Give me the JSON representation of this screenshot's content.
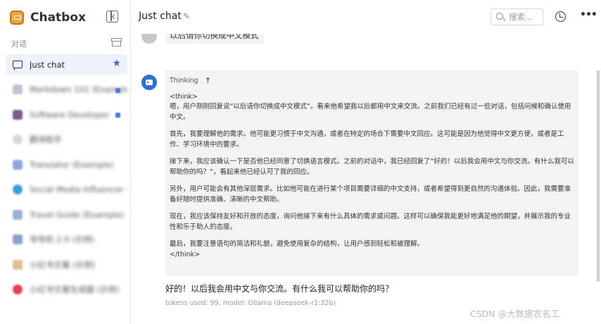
{
  "app": {
    "name": "Chatbox"
  },
  "sidebar": {
    "section_label": "对话",
    "items": [
      {
        "label": "Just chat",
        "icon": "message-icon",
        "active": true,
        "starred": true
      },
      {
        "label": "Markdown 101 (Example)",
        "icon": "image-icon"
      },
      {
        "label": "Software Developer",
        "icon": "image-icon"
      },
      {
        "label": "翻译助手",
        "icon": "avatar-icon"
      },
      {
        "label": "Translator (Example)",
        "icon": "avatar-icon"
      },
      {
        "label": "Social Media Influencer (Example)",
        "icon": "avatar-icon"
      },
      {
        "label": "Travel Guide (Example)",
        "icon": "avatar-icon"
      },
      {
        "label": "夸夸机 2.0 (示例)",
        "icon": "avatar-icon"
      },
      {
        "label": "小红书文案 (示例)",
        "icon": "avatar-icon"
      },
      {
        "label": "小红书文案生成器 (示例)",
        "icon": "avatar-icon"
      }
    ]
  },
  "header": {
    "title": "Just chat",
    "search_placeholder": "搜索..."
  },
  "conversation": {
    "user_message": "以后请你切换成中文模式",
    "thinking_label": "Thinking",
    "think_open": "<think>",
    "think_close": "</think>",
    "thinking_paragraphs": [
      "嗯，用户刚刚回复说“以后请你切换成中文模式”。看来他希望我以后都用中文来交流。之前我们已经有过一些对话，包括问候和确认使用中文。",
      "首先，我要理解他的需求。他可能更习惯于中文沟通，或者在特定的场合下需要中文回应。这可能是因为他觉得中文更方便，或者是工作、学习环境中的要求。",
      "接下来，我应该确认一下是否他已经同意了切换语言模式。之前的对话中，我已经回复了“好的！以后我会用中文与你交流。有什么我可以帮助你的吗？”，看起来他已经认可了我的回应。",
      "另外，用户可能会有其他深层需求。比如他可能在进行某个项目需要详细的中文支持，或者希望得到更自然的沟通体验。因此，我需要准备好随时提供准确、清晰的中文帮助。",
      "现在，我应该保持友好和开放的态度，询问他接下来有什么具体的需求或问题。这样可以确保我能更好地满足他的期望，并展示我的专业性和乐于助人的态度。",
      "最后，我要注意语句的简洁和礼貌，避免使用复杂的结构，让用户感到轻松和被理解。"
    ],
    "answer": "好的！以后我会用中文与你交流。有什么我可以帮助你的吗？",
    "meta": "tokens used: 99, model: Ollama (deepseek-r1:32b)"
  },
  "watermark": "CSDN @大数据农名工",
  "colors": {
    "accent": "#3a6fd8",
    "bot_avatar": "#2f6fd0",
    "active_bg": "#eef3fb",
    "logo": "#f0a53a"
  }
}
